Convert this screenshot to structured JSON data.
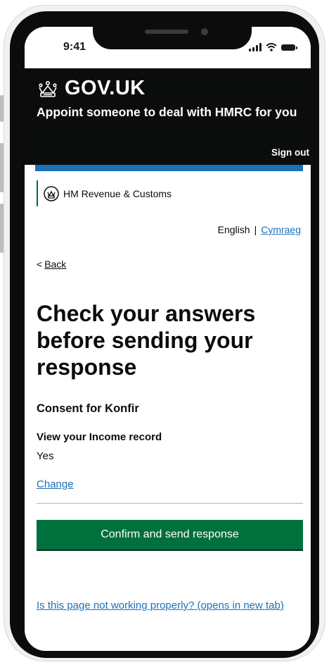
{
  "status_bar": {
    "time": "9:41"
  },
  "header": {
    "logo_text": "GOV.UK",
    "service_name": "Appoint someone to deal with HMRC for you",
    "sign_out": "Sign out"
  },
  "hmrc": {
    "label": "HM Revenue & Customs"
  },
  "language": {
    "english": "English",
    "separator": "|",
    "welsh": "Cymraeg"
  },
  "back_link": {
    "chevron": "<",
    "label": "Back"
  },
  "page": {
    "title": "Check your answers before sending your response",
    "section": "Consent for Konfir",
    "summary": {
      "key": "View your Income record",
      "value": "Yes",
      "action": "Change"
    },
    "confirm_button": "Confirm and send response",
    "feedback_link": "Is this page not working properly? (opens in new tab)"
  },
  "colors": {
    "header_bg": "#0b0c0c",
    "link": "#1d70b8",
    "button": "#00703c",
    "hmrc_stripe": "#00703c"
  },
  "icons": [
    "crown-icon",
    "hmrc-crest-icon",
    "signal-icon",
    "wifi-icon",
    "battery-icon"
  ]
}
